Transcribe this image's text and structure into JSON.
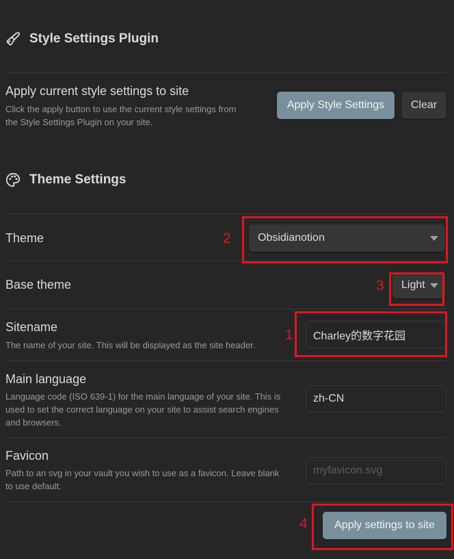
{
  "style_settings_section": {
    "icon": "paintbrush-icon",
    "title": "Style Settings Plugin",
    "setting": {
      "label": "Apply current style settings to site",
      "description_line1": "Click the apply button to use the current style settings from",
      "description_line2": "the Style Settings Plugin on your site."
    },
    "apply_button": "Apply Style Settings",
    "clear_button": "Clear"
  },
  "theme_settings_section": {
    "icon": "palette-icon",
    "title": "Theme Settings",
    "theme": {
      "label": "Theme",
      "value": "Obsidianotion"
    },
    "base_theme": {
      "label": "Base theme",
      "value": "Light"
    },
    "sitename": {
      "label": "Sitename",
      "description": "The name of your site. This will be displayed as the site header.",
      "value": "Charley的数字花园"
    },
    "main_language": {
      "label": "Main language",
      "description_line1": "Language code (ISO 639-1) for the main language of your site. This is",
      "description_line2": "used to set the correct language on your site to assist search engines",
      "description_line3": "and browsers.",
      "value": "zh-CN"
    },
    "favicon": {
      "label": "Favicon",
      "description_line1": "Path to an svg in your vault you wish to use as a favicon. Leave blank",
      "description_line2": "to use default.",
      "value": "",
      "placeholder": "myfavicon.svg"
    },
    "apply_button": "Apply settings to site"
  },
  "annotations": {
    "accent_color": "#e0161e",
    "sitename": "1",
    "theme": "2",
    "base_theme": "3",
    "apply": "4"
  }
}
